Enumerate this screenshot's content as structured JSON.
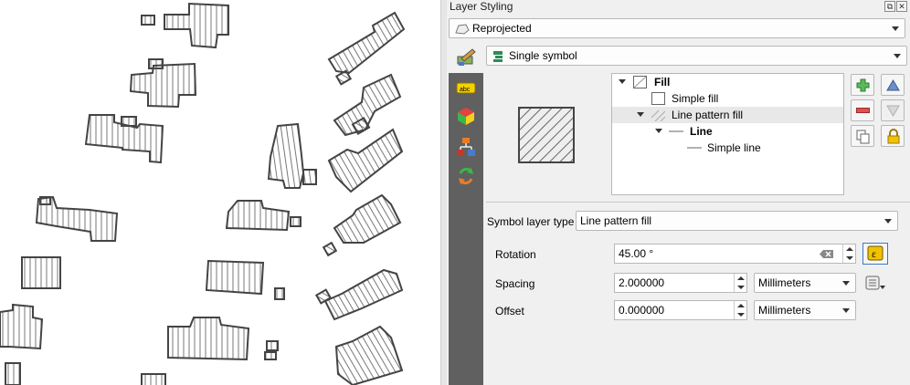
{
  "panel": {
    "title": "Layer Styling",
    "layer_combo": "Reprojected",
    "renderer_combo": "Single symbol"
  },
  "tree": {
    "items": [
      {
        "label": "Fill",
        "bold": true
      },
      {
        "label": "Simple fill",
        "bold": false
      },
      {
        "label": "Line pattern fill",
        "bold": false
      },
      {
        "label": "Line",
        "bold": true
      },
      {
        "label": "Simple line",
        "bold": false
      }
    ]
  },
  "symbol_layer": {
    "type_label": "Symbol layer type",
    "type_value": "Line pattern fill"
  },
  "props": {
    "rotation_label": "Rotation",
    "rotation_value": "45.00 °",
    "spacing_label": "Spacing",
    "spacing_value": "2.000000",
    "spacing_unit": "Millimeters",
    "offset_label": "Offset",
    "offset_value": "0.000000",
    "offset_unit": "Millimeters"
  },
  "icons": {
    "sidebar": [
      "labels-icon",
      "3d-view-icon",
      "diagrams-icon",
      "history-icon"
    ],
    "tools": [
      "add-symbol-layer-icon",
      "remove-symbol-layer-icon",
      "duplicate-symbol-layer-icon",
      "move-up-icon",
      "move-down-icon",
      "lock-icon"
    ]
  },
  "colors": {
    "sidebar_bg": "#606060",
    "panel_bg": "#f0f0f0",
    "tree_selected": "#e8e8e8",
    "map_outline": "#444444"
  }
}
